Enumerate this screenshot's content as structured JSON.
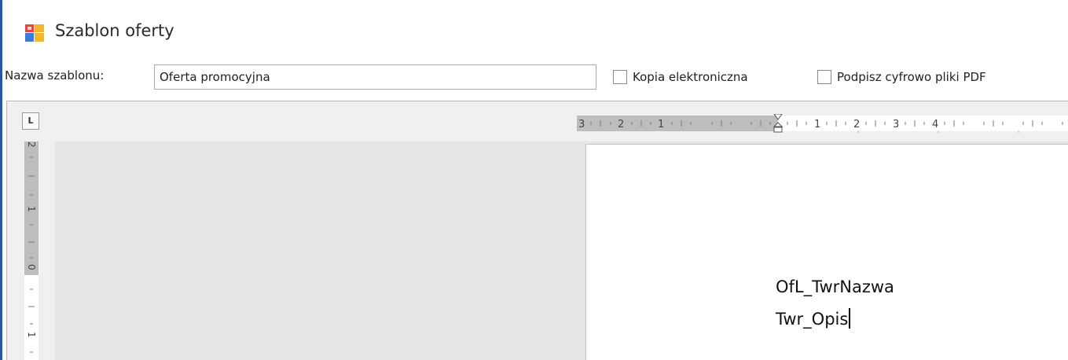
{
  "window": {
    "title": "Szablon oferty",
    "accent_color": "#2b5797"
  },
  "form": {
    "template_name_label": "Nazwa szablonu:",
    "template_name_value": "Oferta promocyjna",
    "checkboxes": [
      {
        "label": "Kopia elektroniczna",
        "checked": false
      },
      {
        "label": "Podpisz cyfrowo pliki PDF",
        "checked": false
      }
    ]
  },
  "editor": {
    "tab_selector_glyph": "L",
    "horizontal_ruler_labels": [
      "3",
      "2",
      "1",
      "1",
      "2",
      "3",
      "4"
    ],
    "vertical_ruler_labels": [
      "2",
      "1",
      "0",
      "1"
    ],
    "document_lines": [
      "OfL_TwrNazwa",
      "Twr_Opis"
    ]
  },
  "icons": {
    "app_icon": "template-form-icon",
    "tab_selector": "tab-stop-left-icon"
  }
}
